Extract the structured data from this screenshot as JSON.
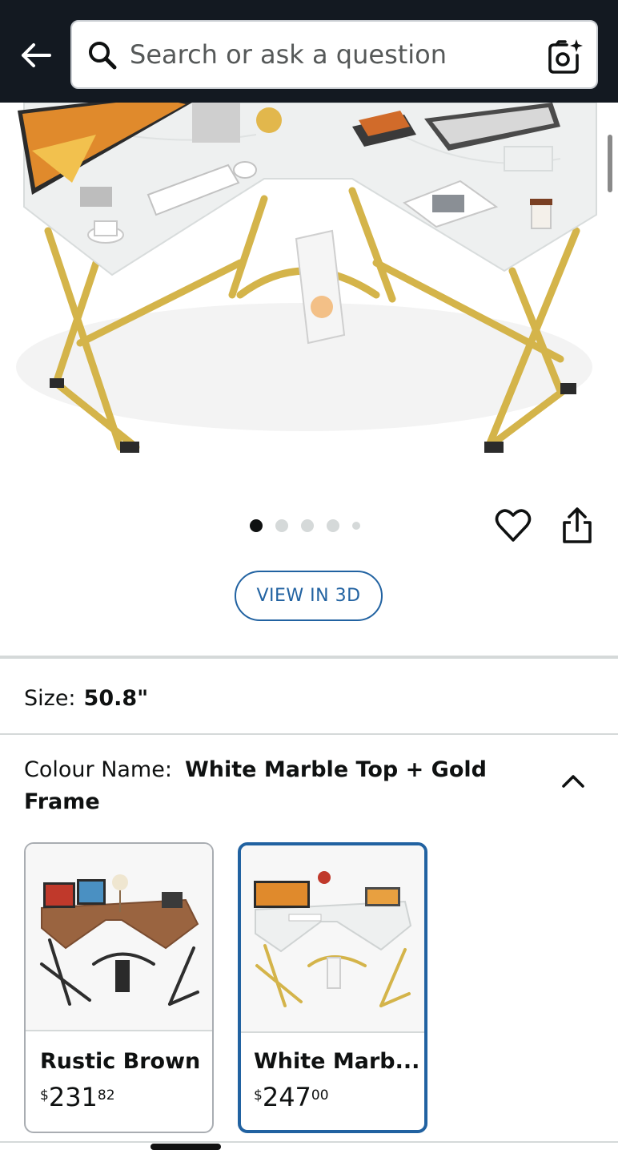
{
  "header": {
    "search_placeholder": "Search or ask a question"
  },
  "product": {
    "image_count": 5,
    "active_image": 1,
    "view3d_label": "VIEW IN 3D"
  },
  "size": {
    "label": "Size:",
    "value": "50.8\""
  },
  "colour": {
    "label": "Colour Name:",
    "value": "White Marble Top + Gold Frame"
  },
  "swatches": [
    {
      "name": "Rustic Brown",
      "currency": "$",
      "dollars": "231",
      "cents": "82",
      "selected": false
    },
    {
      "name": "White Marb...",
      "currency": "$",
      "dollars": "247",
      "cents": "00",
      "selected": true
    }
  ],
  "colors": {
    "header_bg": "#131921",
    "accent_blue": "#2162a1",
    "frame_gold": "#d4b44a",
    "desk_white": "#eef0f0",
    "desk_brown": "#9a6440"
  },
  "icons": [
    "back-arrow-icon",
    "search-icon",
    "camera-icon",
    "heart-icon",
    "share-icon",
    "chevron-up-icon"
  ]
}
